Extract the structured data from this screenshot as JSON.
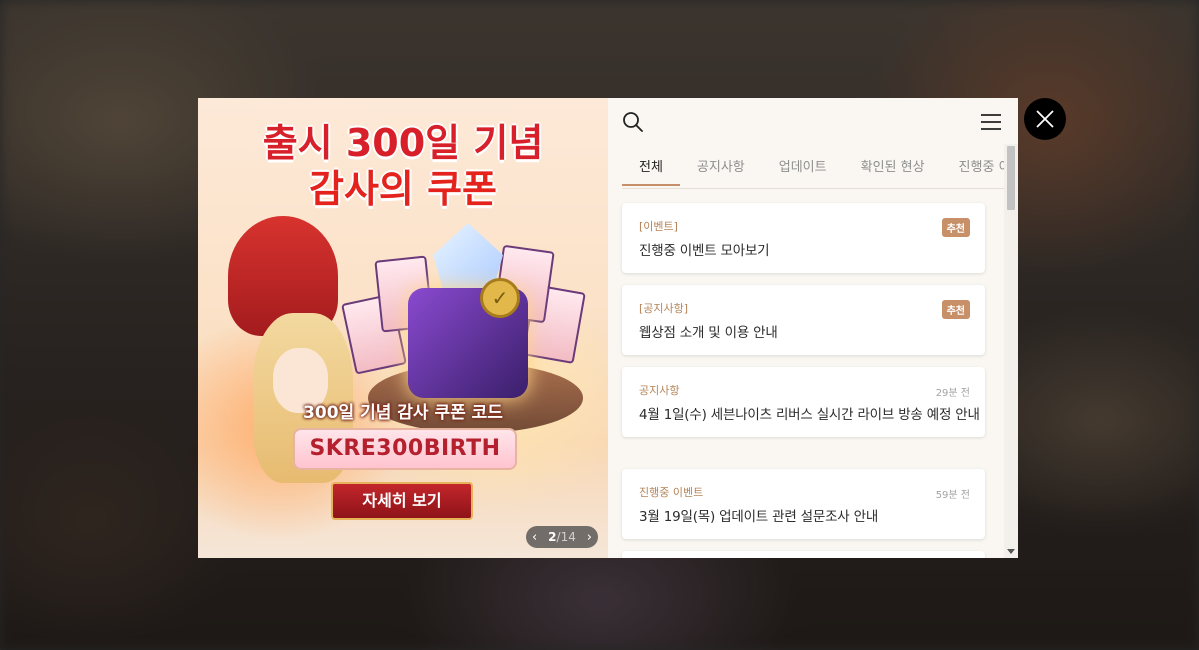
{
  "banner": {
    "title_line1": "출시 300일 기념",
    "title_line2": "감사의 쿠폰",
    "coupon_label": "300일 기념 감사 쿠폰 코드",
    "coupon_code": "SKRE300BIRTH",
    "detail_button": "자세히 보기",
    "pager": {
      "current": "2",
      "separator": "/",
      "total": "14",
      "prev": "‹",
      "next": "›"
    }
  },
  "tabs": [
    "전체",
    "공지사항",
    "업데이트",
    "확인된 현상",
    "진행중 이벤트"
  ],
  "active_tab": "전체",
  "posts": [
    {
      "category": "[이벤트]",
      "title": "진행중 이벤트 모아보기",
      "badge": "추천"
    },
    {
      "category": "[공지사항]",
      "title": "웹상점 소개 및 이용 안내",
      "badge": "추천"
    },
    {
      "category": "공지사항",
      "title": "4월 1일(수) 세븐나이츠 리버스 실시간 라이브 방송 예정 안내",
      "time": "29분 전"
    },
    {
      "category": "진행중 이벤트",
      "title": "3월 19일(목) 업데이트 관련 설문조사 안내",
      "time": "59분 전"
    }
  ],
  "colors": {
    "accent": "#c89069",
    "category": "#b58458",
    "close_bg": "#000000"
  },
  "icons": {
    "search": "search-icon",
    "menu": "menu-icon",
    "close": "close-icon"
  }
}
